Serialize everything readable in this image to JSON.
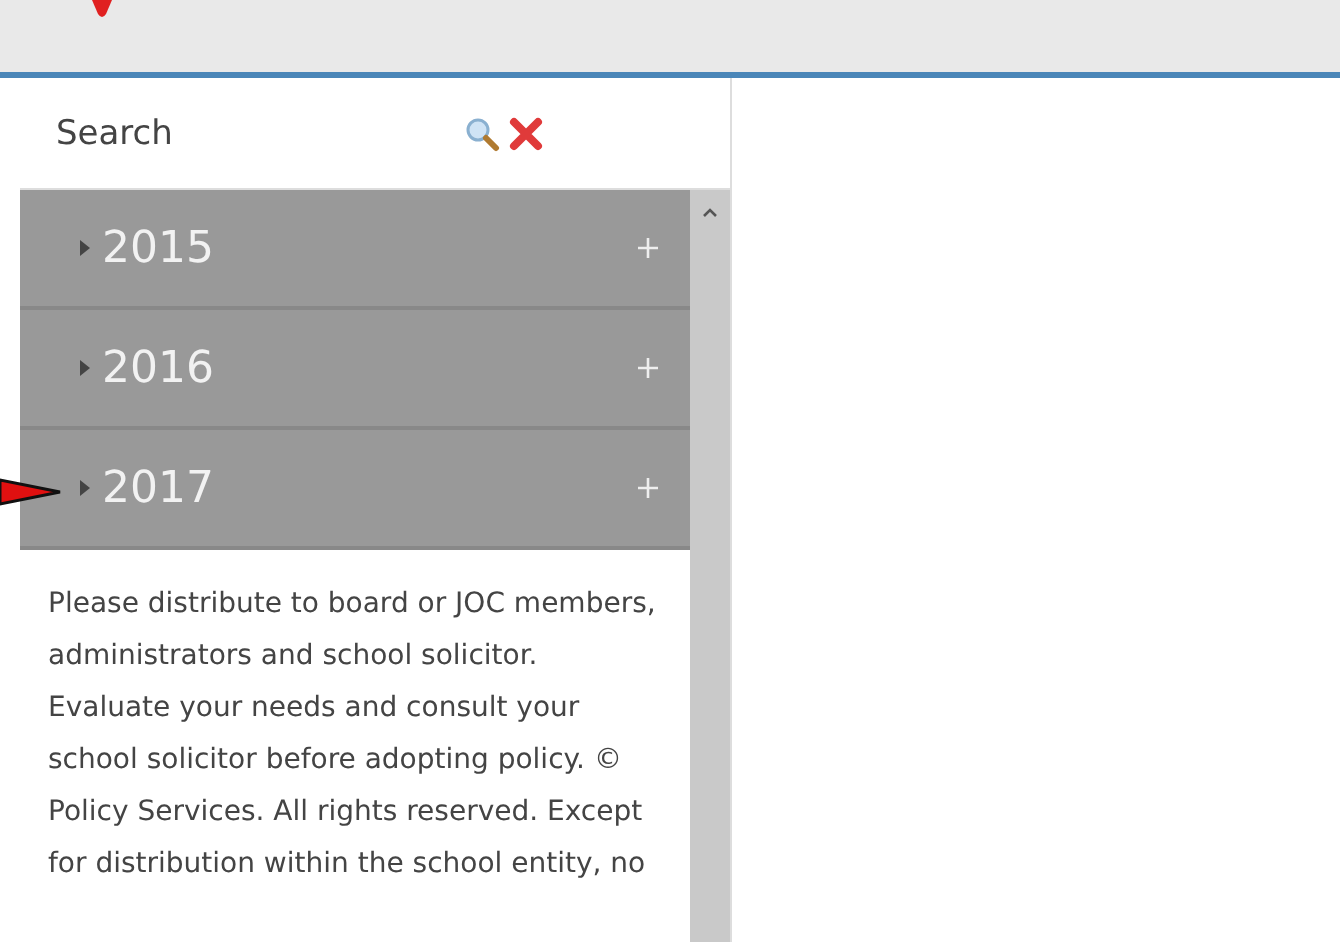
{
  "search": {
    "label": "Search"
  },
  "years": [
    {
      "label": "2015",
      "expanded": false
    },
    {
      "label": "2016",
      "expanded": false
    },
    {
      "label": "2017",
      "expanded": false
    }
  ],
  "notice": "Please distribute to board or JOC members, administrators and school solicitor. Evaluate your needs and consult your school solicitor before adopting policy. ©             Policy Services. All rights reserved. Except for distribution within the school entity, no"
}
